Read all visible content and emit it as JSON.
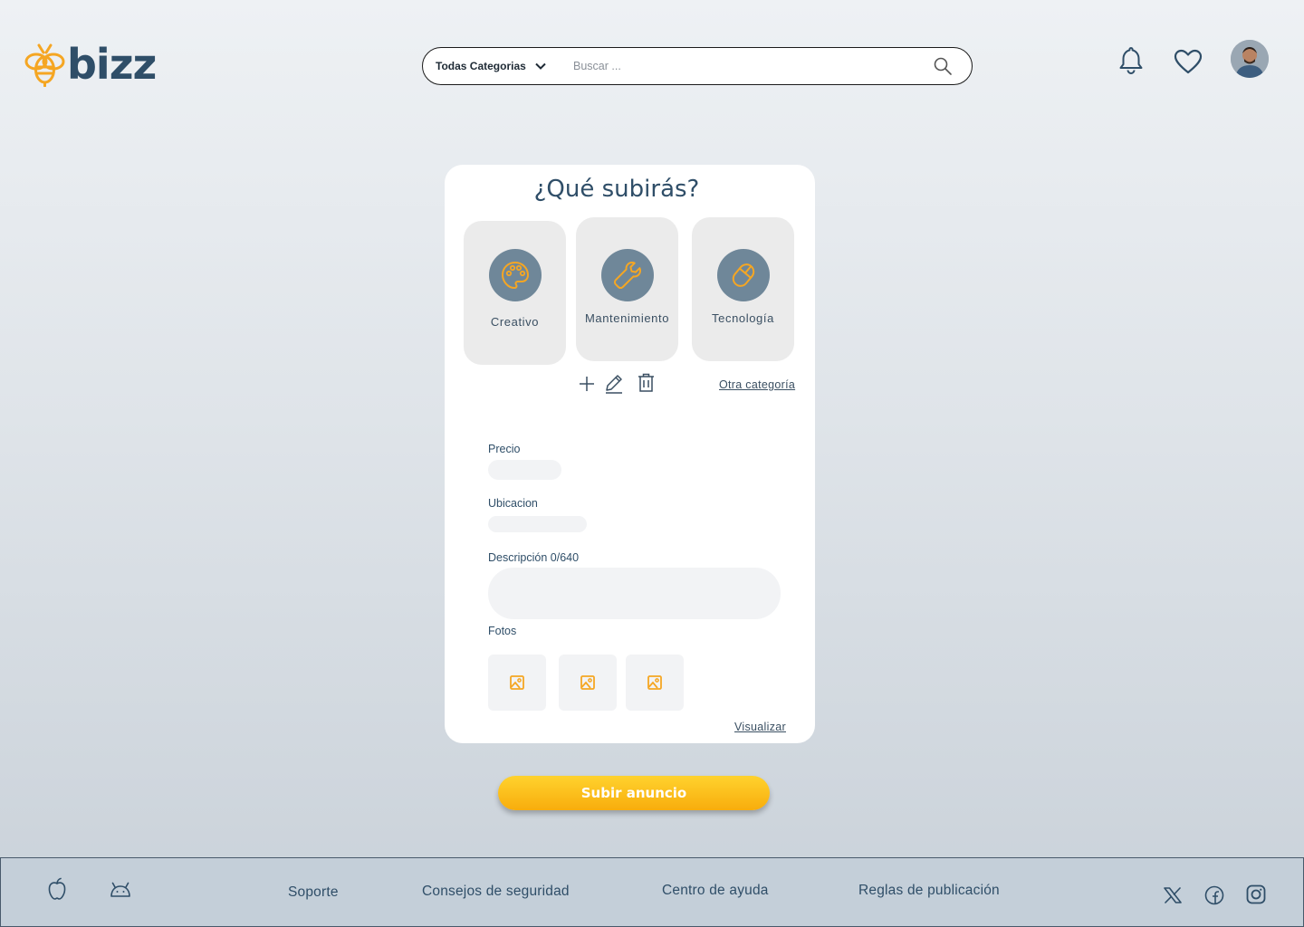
{
  "header": {
    "logo_text": "bizz",
    "search": {
      "category_label": "Todas Categorias",
      "placeholder": "Buscar ..."
    }
  },
  "form": {
    "title": "¿Qué subirás?",
    "categories": [
      {
        "label": "Creativo",
        "icon": "palette-icon"
      },
      {
        "label": "Mantenimiento",
        "icon": "wrench-icon"
      },
      {
        "label": "Tecnología",
        "icon": "mouse-icon"
      }
    ],
    "other_category_link": "Otra categoría",
    "fields": {
      "price_label": "Precio",
      "location_label": "Ubicacion",
      "description_label": "Descripción 0/640",
      "photos_label": "Fotos"
    },
    "preview_link": "Visualizar",
    "submit_label": "Subir anuncio"
  },
  "footer": {
    "links": [
      "Soporte",
      "Consejos de seguridad",
      "Centro de ayuda",
      "Reglas de publicación"
    ]
  },
  "colors": {
    "accent": "#f5a623",
    "primary": "#2f4e68",
    "icon_circle": "#6f8799"
  }
}
